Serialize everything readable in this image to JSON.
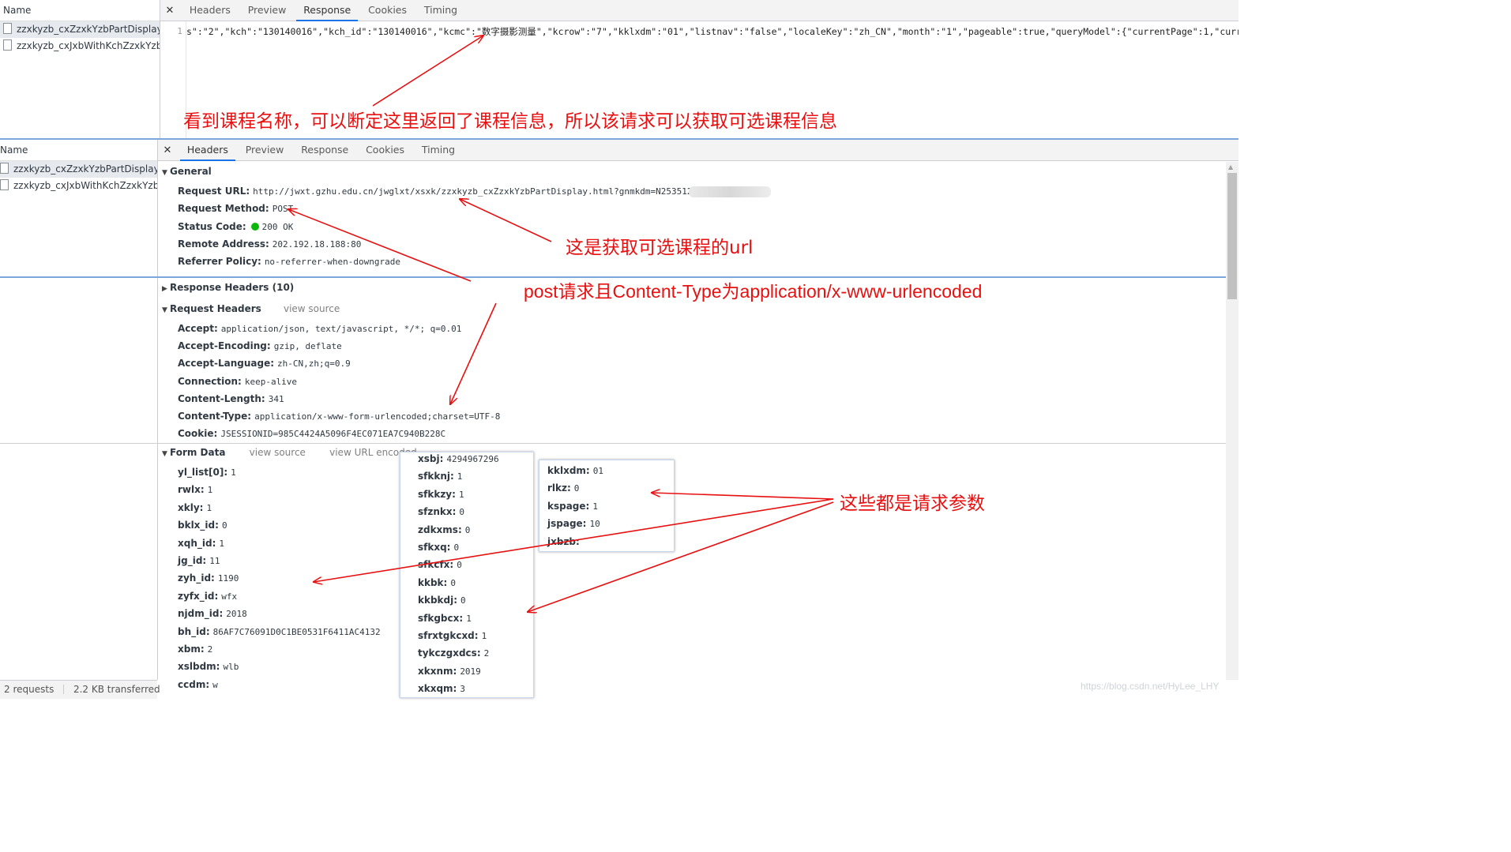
{
  "top_panel": {
    "name_header": "Name",
    "requests": [
      {
        "name": "zzxkyzb_cxZzxkYzbPartDisplay...."
      },
      {
        "name": "zzxkyzb_cxJxbWithKchZzxkYzb..."
      }
    ],
    "tabs": [
      "Headers",
      "Preview",
      "Response",
      "Cookies",
      "Timing"
    ],
    "active_tab": "Response",
    "line_number": "1",
    "response_text": "s\":\"2\",\"kch\":\"130140016\",\"kch_id\":\"130140016\",\"kcmc\":\"数字摄影测量\",\"kcrow\":\"7\",\"kklxdm\":\"01\",\"listnav\":\"false\",\"localeKey\":\"zh_CN\",\"month\":\"1\",\"pageable\":true,\"queryModel\":{\"currentPage\":1,\"curren"
  },
  "bottom_panel": {
    "name_header": "Name",
    "requests": [
      {
        "name": "zzxkyzb_cxZzxkYzbPartDisplay...."
      },
      {
        "name": "zzxkyzb_cxJxbWithKchZzxkYzb..."
      }
    ],
    "tabs": [
      "Headers",
      "Preview",
      "Response",
      "Cookies",
      "Timing"
    ],
    "active_tab": "Headers",
    "status_bar": {
      "requests": "2 requests",
      "transferred": "2.2 KB transferred"
    }
  },
  "general": {
    "title": "General",
    "rows": [
      {
        "key": "Request URL:",
        "value": "http://jwxt.gzhu.edu.cn/jwglxt/xsxk/zzxkyzb_cxZzxkYzbPartDisplay.html?gnmkdm=N253512"
      },
      {
        "key": "Request Method:",
        "value": "POST"
      },
      {
        "key": "Status Code:",
        "value": "200 OK"
      },
      {
        "key": "Remote Address:",
        "value": "202.192.18.188:80"
      },
      {
        "key": "Referrer Policy:",
        "value": "no-referrer-when-downgrade"
      }
    ],
    "status_color": "#0ab80a"
  },
  "response_headers": {
    "title": "Response Headers (10)"
  },
  "request_headers": {
    "title": "Request Headers",
    "view_source": "view source",
    "rows": [
      {
        "key": "Accept:",
        "value": "application/json, text/javascript, */*; q=0.01"
      },
      {
        "key": "Accept-Encoding:",
        "value": "gzip, deflate"
      },
      {
        "key": "Accept-Language:",
        "value": "zh-CN,zh;q=0.9"
      },
      {
        "key": "Connection:",
        "value": "keep-alive"
      },
      {
        "key": "Content-Length:",
        "value": "341"
      },
      {
        "key": "Content-Type:",
        "value": "application/x-www-form-urlencoded;charset=UTF-8"
      },
      {
        "key": "Cookie:",
        "value": "JSESSIONID=985C4424A5096F4EC071EA7C940B228C"
      }
    ]
  },
  "form_data": {
    "title": "Form Data",
    "view_source": "view source",
    "view_url_encoded": "view URL encoded",
    "col1": [
      {
        "key": "yl_list[0]:",
        "value": "1"
      },
      {
        "key": "rwlx:",
        "value": "1"
      },
      {
        "key": "xkly:",
        "value": "1"
      },
      {
        "key": "bklx_id:",
        "value": "0"
      },
      {
        "key": "xqh_id:",
        "value": "1"
      },
      {
        "key": "jg_id:",
        "value": "11"
      },
      {
        "key": "zyh_id:",
        "value": "1190"
      },
      {
        "key": "zyfx_id:",
        "value": "wfx"
      },
      {
        "key": "njdm_id:",
        "value": "2018"
      },
      {
        "key": "bh_id:",
        "value": "86AF7C76091D0C1BE0531F6411AC4132"
      },
      {
        "key": "xbm:",
        "value": "2"
      },
      {
        "key": "xslbdm:",
        "value": "wlb"
      },
      {
        "key": "ccdm:",
        "value": "w"
      }
    ],
    "col2": [
      {
        "key": "xsbj:",
        "value": "4294967296"
      },
      {
        "key": "sfkknj:",
        "value": "1"
      },
      {
        "key": "sfkkzy:",
        "value": "1"
      },
      {
        "key": "sfznkx:",
        "value": "0"
      },
      {
        "key": "zdkxms:",
        "value": "0"
      },
      {
        "key": "sfkxq:",
        "value": "0"
      },
      {
        "key": "sfkcfx:",
        "value": "0"
      },
      {
        "key": "kkbk:",
        "value": "0"
      },
      {
        "key": "kkbkdj:",
        "value": "0"
      },
      {
        "key": "sfkgbcx:",
        "value": "1"
      },
      {
        "key": "sfrxtgkcxd:",
        "value": "1"
      },
      {
        "key": "tykczgxdcs:",
        "value": "2"
      },
      {
        "key": "xkxnm:",
        "value": "2019"
      },
      {
        "key": "xkxqm:",
        "value": "3"
      }
    ],
    "col3": [
      {
        "key": "kklxdm:",
        "value": "01"
      },
      {
        "key": "rlkz:",
        "value": "0"
      },
      {
        "key": "kspage:",
        "value": "1"
      },
      {
        "key": "jspage:",
        "value": "10"
      },
      {
        "key": "jxbzb:",
        "value": ""
      }
    ]
  },
  "annotations": {
    "a1": "看到课程名称，可以断定这里返回了课程信息，所以该请求可以获取可选课程信息",
    "a2": "这是获取可选课程的url",
    "a3": "post请求且Content-Type为application/x-www-urlencoded",
    "a4": "这些都是请求参数",
    "color": "#e81010"
  },
  "watermark": "https://blog.csdn.net/HyLee_LHY"
}
